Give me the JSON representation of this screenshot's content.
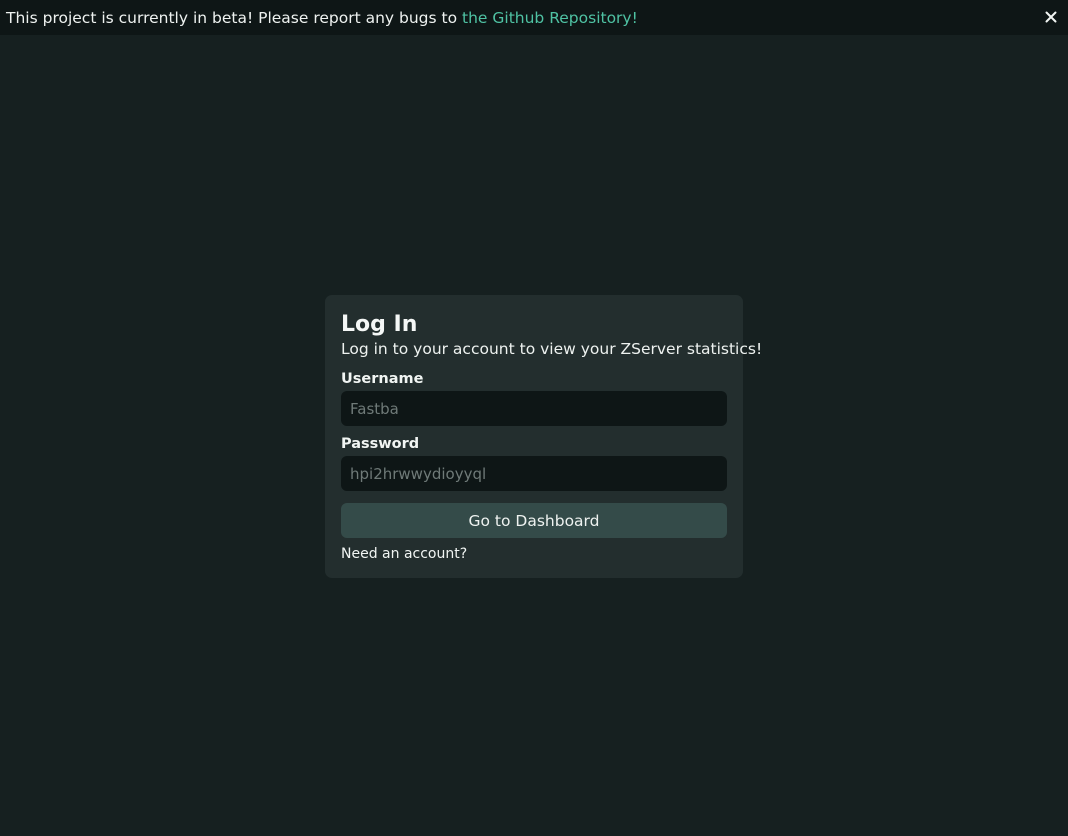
{
  "banner": {
    "message": "This project is currently in beta! Please report any bugs to ",
    "link_text": "the Github Repository!",
    "close_icon": "close-icon"
  },
  "login": {
    "title": "Log In",
    "subtitle": "Log in to your account to view your ZServer statistics!",
    "username_label": "Username",
    "username_placeholder": "Fastba",
    "password_label": "Password",
    "password_placeholder": "hpi2hrwwydioyyql",
    "submit_label": "Go to Dashboard",
    "signup_link": "Need an account?"
  },
  "colors": {
    "background": "#162020",
    "banner_bg": "#0e1616",
    "card_bg": "#232e2e",
    "accent_link": "#4fc2a3",
    "button_bg": "#344b49"
  }
}
